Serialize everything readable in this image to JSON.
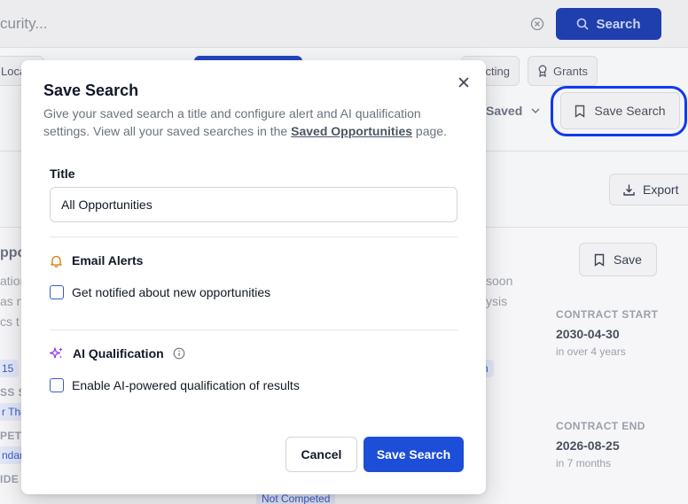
{
  "background": {
    "search_value": "curity...",
    "search_button_label": "Search",
    "filter_chips": [
      {
        "label": "Loca"
      },
      {
        "label": ""
      },
      {
        "label": "cting"
      },
      {
        "label": "Grants"
      }
    ],
    "saved_dropdown_label": "Saved",
    "save_search_label": "Save Search",
    "export_label": "Export",
    "card_save_label": "Save",
    "card_title_fragment": "ppo",
    "card_text_fragments": [
      "ation",
      "as n",
      "cs t",
      "soon",
      "ysis"
    ],
    "left_fragments": [
      "15",
      "SS S",
      "r Tha",
      "PETI",
      "ndar",
      "IDE"
    ],
    "tag_right": "n",
    "tag_bottom": "Not Competed",
    "contract_start_label": "CONTRACT START",
    "contract_start_value": "2030-04-30",
    "contract_start_sub": "in over 4 years",
    "contract_end_label": "CONTRACT END",
    "contract_end_value": "2026-08-25",
    "contract_end_sub": "in 7 months",
    "colors": {
      "primary": "#1d4ed8",
      "highlight": "#1239f0"
    }
  },
  "modal": {
    "title": "Save Search",
    "desc_prefix": "Give your saved search a title and configure alert and AI qualification settings. View all your saved searches in the ",
    "desc_link": "Saved Opportunities",
    "desc_suffix": " page.",
    "title_label": "Title",
    "title_value": "All Opportunities",
    "email_alerts_heading": "Email Alerts",
    "email_alerts_checkbox": "Get notified about new opportunities",
    "ai_heading": "AI Qualification",
    "ai_checkbox": "Enable AI-powered qualification of results",
    "cancel_label": "Cancel",
    "save_label": "Save Search",
    "icons": {
      "close": "close-icon",
      "bell": "bell-icon",
      "sparkles": "sparkles-icon",
      "info": "info-icon"
    }
  }
}
